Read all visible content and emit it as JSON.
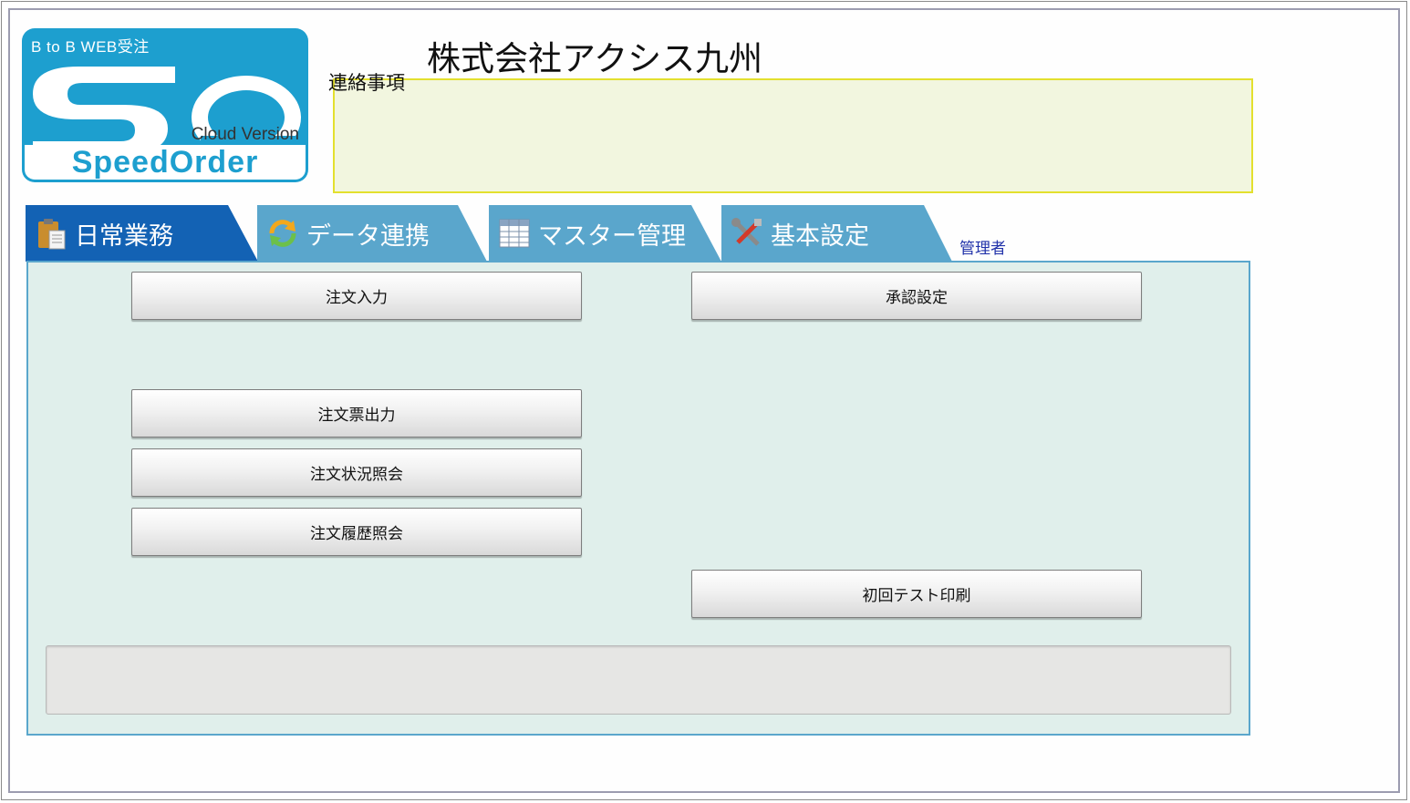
{
  "logo": {
    "btob": "B to B  WEB受注",
    "cloud": "Cloud Version",
    "name": "SpeedOrder",
    "mark": "SO"
  },
  "header": {
    "company": "株式会社アクシス九州",
    "notice_label": "連絡事項",
    "notice_text": ""
  },
  "tabs": [
    {
      "label": "日常業務",
      "icon": "clipboard-icon",
      "active": true
    },
    {
      "label": "データ連携",
      "icon": "sync-icon",
      "active": false
    },
    {
      "label": "マスター管理",
      "icon": "table-icon",
      "active": false
    },
    {
      "label": "基本設定",
      "icon": "tools-icon",
      "active": false
    }
  ],
  "user_role": "管理者",
  "buttons": {
    "order_entry": "注文入力",
    "approval_settings": "承認設定",
    "order_slip_output": "注文票出力",
    "order_status": "注文状況照会",
    "order_history": "注文履歴照会",
    "first_test_print": "初回テスト印刷"
  },
  "status_message": "",
  "colors": {
    "active_tab": "#1362b4",
    "inactive_tab": "#5aa6cc",
    "panel_bg": "#e0efeb",
    "notice_bg": "#f2f6df",
    "notice_border": "#e3e02e",
    "logo_blue": "#1d9fcf"
  }
}
